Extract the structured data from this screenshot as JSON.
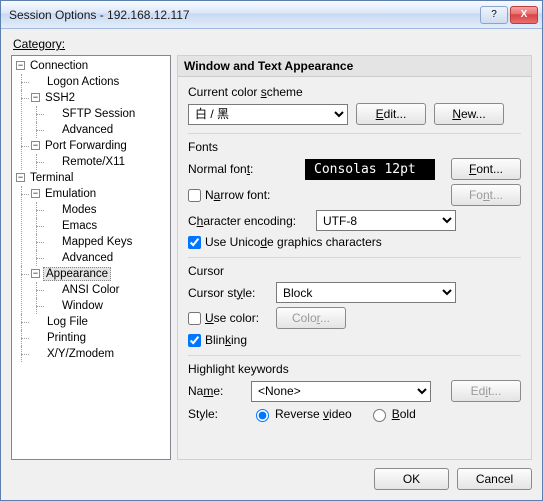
{
  "window": {
    "title": "Session Options - 192.168.12.117",
    "close_x": "X",
    "help_q": "?"
  },
  "category_label": "Category:",
  "tree": {
    "connection": "Connection",
    "logon_actions": "Logon Actions",
    "ssh2": "SSH2",
    "sftp_session": "SFTP Session",
    "advanced": "Advanced",
    "port_forwarding": "Port Forwarding",
    "remote_x11": "Remote/X11",
    "terminal": "Terminal",
    "emulation": "Emulation",
    "modes": "Modes",
    "emacs": "Emacs",
    "mapped_keys": "Mapped Keys",
    "advanced2": "Advanced",
    "appearance": "Appearance",
    "ansi_color": "ANSI Color",
    "window_node": "Window",
    "log_file": "Log File",
    "printing": "Printing",
    "xyzmodem": "X/Y/Zmodem"
  },
  "panel": {
    "header": "Window and Text Appearance",
    "scheme_label": "Current color scheme",
    "scheme_value": "白 / 黑",
    "edit_btn": "Edit...",
    "new_btn": "New...",
    "fonts_title": "Fonts",
    "normal_font_label": "Normal font:",
    "font_preview": "Consolas  12pt",
    "font_btn": "Font...",
    "narrow_font_label": "Narrow font:",
    "narrow_font_checked": false,
    "char_enc_label": "Character encoding:",
    "char_enc_value": "UTF-8",
    "unicode_gfx_label": "Use Unicode graphics characters",
    "unicode_gfx_checked": true,
    "cursor_title": "Cursor",
    "cursor_style_label": "Cursor style:",
    "cursor_style_value": "Block",
    "use_color_label": "Use color:",
    "use_color_checked": false,
    "color_btn": "Color...",
    "blinking_label": "Blinking",
    "blinking_checked": true,
    "highlight_title": "Highlight keywords",
    "name_label": "Name:",
    "name_value": "<None>",
    "hl_edit_btn": "Edit...",
    "style_label": "Style:",
    "reverse_label": "Reverse video",
    "bold_label": "Bold"
  },
  "footer": {
    "ok": "OK",
    "cancel": "Cancel"
  }
}
